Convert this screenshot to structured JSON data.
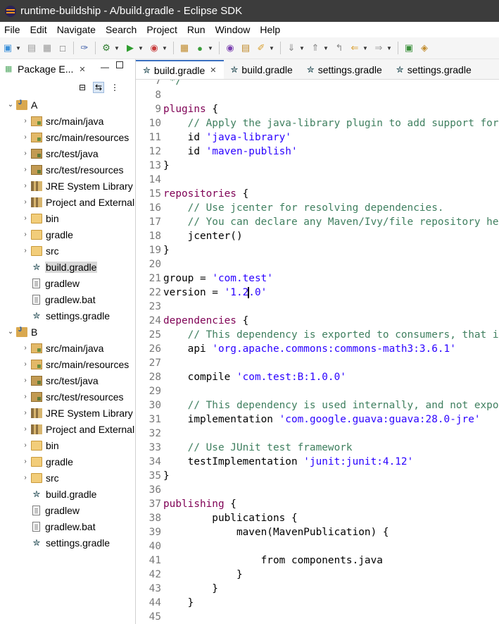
{
  "window": {
    "title": "runtime-buildship - A/build.gradle - Eclipse SDK"
  },
  "menu": [
    "File",
    "Edit",
    "Navigate",
    "Search",
    "Project",
    "Run",
    "Window",
    "Help"
  ],
  "package_explorer": {
    "tab_label": "Package E...",
    "projects": [
      {
        "name": "A",
        "children": [
          {
            "label": "src/main/java",
            "icon": "source-folder-icon"
          },
          {
            "label": "src/main/resources",
            "icon": "source-folder-icon"
          },
          {
            "label": "src/test/java",
            "icon": "test-source-folder-icon"
          },
          {
            "label": "src/test/resources",
            "icon": "test-source-folder-icon"
          },
          {
            "label": "JRE System Library",
            "icon": "library-icon"
          },
          {
            "label": "Project and External Dependencies",
            "icon": "library-icon"
          },
          {
            "label": "bin",
            "icon": "folder-icon"
          },
          {
            "label": "gradle",
            "icon": "folder-icon"
          },
          {
            "label": "src",
            "icon": "folder-icon"
          },
          {
            "label": "build.gradle",
            "icon": "gradle-elephant-icon",
            "selected": true
          },
          {
            "label": "gradlew",
            "icon": "file-icon"
          },
          {
            "label": "gradlew.bat",
            "icon": "file-icon"
          },
          {
            "label": "settings.gradle",
            "icon": "gradle-elephant-icon"
          }
        ]
      },
      {
        "name": "B",
        "children": [
          {
            "label": "src/main/java",
            "icon": "source-folder-icon"
          },
          {
            "label": "src/main/resources",
            "icon": "source-folder-icon"
          },
          {
            "label": "src/test/java",
            "icon": "test-source-folder-icon"
          },
          {
            "label": "src/test/resources",
            "icon": "test-source-folder-icon"
          },
          {
            "label": "JRE System Library",
            "icon": "library-icon"
          },
          {
            "label": "Project and External Dependencies",
            "icon": "library-icon"
          },
          {
            "label": "bin",
            "icon": "folder-icon"
          },
          {
            "label": "gradle",
            "icon": "folder-icon"
          },
          {
            "label": "src",
            "icon": "folder-icon"
          },
          {
            "label": "build.gradle",
            "icon": "gradle-elephant-icon"
          },
          {
            "label": "gradlew",
            "icon": "file-icon"
          },
          {
            "label": "gradlew.bat",
            "icon": "file-icon"
          },
          {
            "label": "settings.gradle",
            "icon": "gradle-elephant-icon"
          }
        ]
      }
    ]
  },
  "editor": {
    "tabs": [
      {
        "label": "build.gradle",
        "active": true
      },
      {
        "label": "build.gradle",
        "active": false
      },
      {
        "label": "settings.gradle",
        "active": false
      },
      {
        "label": "settings.gradle",
        "active": false
      }
    ],
    "lines": [
      {
        "n": "7",
        "text": " */"
      },
      {
        "n": "8",
        "text": ""
      },
      {
        "n": "9",
        "text": "plugins {"
      },
      {
        "n": "10",
        "text": "    // Apply the java-library plugin to add support for Java Library"
      },
      {
        "n": "11",
        "text": "    id 'java-library'"
      },
      {
        "n": "12",
        "text": "    id 'maven-publish'"
      },
      {
        "n": "13",
        "text": "}"
      },
      {
        "n": "14",
        "text": ""
      },
      {
        "n": "15",
        "text": "repositories {"
      },
      {
        "n": "16",
        "text": "    // Use jcenter for resolving dependencies."
      },
      {
        "n": "17",
        "text": "    // You can declare any Maven/Ivy/file repository here."
      },
      {
        "n": "18",
        "text": "    jcenter()"
      },
      {
        "n": "19",
        "text": "}"
      },
      {
        "n": "20",
        "text": ""
      },
      {
        "n": "21",
        "text": "group = 'com.test'"
      },
      {
        "n": "22",
        "text": "version = '1.2.0'"
      },
      {
        "n": "23",
        "text": ""
      },
      {
        "n": "24",
        "text": "dependencies {"
      },
      {
        "n": "25",
        "text": "    // This dependency is exported to consumers, that is to say found on their compile classpath."
      },
      {
        "n": "26",
        "text": "    api 'org.apache.commons:commons-math3:3.6.1'"
      },
      {
        "n": "27",
        "text": ""
      },
      {
        "n": "28",
        "text": "    compile 'com.test:B:1.0.0'"
      },
      {
        "n": "29",
        "text": ""
      },
      {
        "n": "30",
        "text": "    // This dependency is used internally, and not exposed to consumers on their own compile classpath."
      },
      {
        "n": "31",
        "text": "    implementation 'com.google.guava:guava:28.0-jre'"
      },
      {
        "n": "32",
        "text": ""
      },
      {
        "n": "33",
        "text": "    // Use JUnit test framework"
      },
      {
        "n": "34",
        "text": "    testImplementation 'junit:junit:4.12'"
      },
      {
        "n": "35",
        "text": "}"
      },
      {
        "n": "36",
        "text": ""
      },
      {
        "n": "37",
        "text": "publishing {"
      },
      {
        "n": "38",
        "text": "        publications {"
      },
      {
        "n": "39",
        "text": "            maven(MavenPublication) {"
      },
      {
        "n": "40",
        "text": ""
      },
      {
        "n": "41",
        "text": "                from components.java"
      },
      {
        "n": "42",
        "text": "            }"
      },
      {
        "n": "43",
        "text": "        }"
      },
      {
        "n": "44",
        "text": "    }"
      },
      {
        "n": "45",
        "text": ""
      }
    ],
    "caret": {
      "line": "22",
      "after_text": "version = '1.2"
    },
    "colors": {
      "keyword": "#7f0055",
      "comment": "#3f7f5f",
      "string": "#2a00ff",
      "line_number": "#787878"
    }
  }
}
